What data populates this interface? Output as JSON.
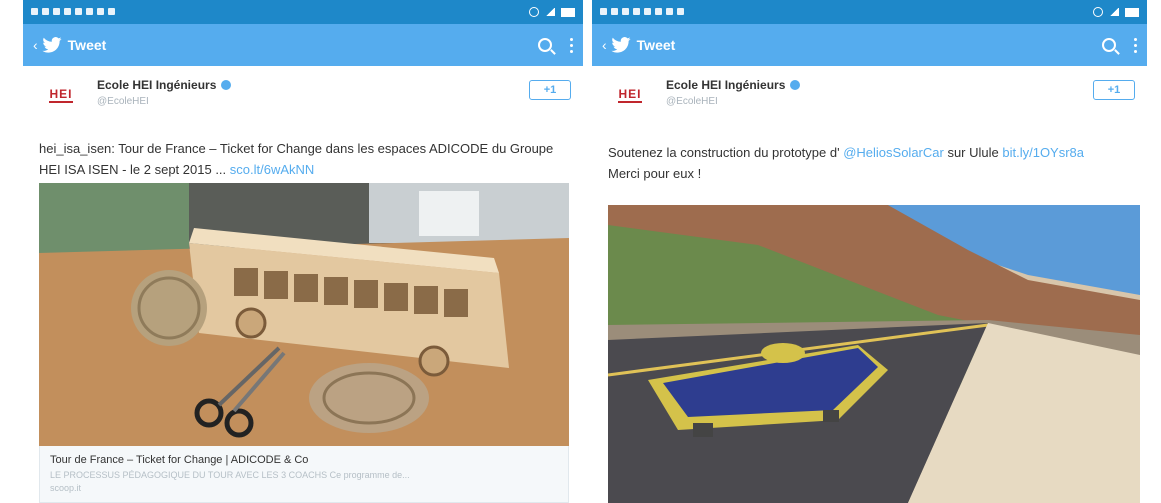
{
  "left": {
    "app_title": "Tweet",
    "account": {
      "name": "Ecole HEI Ingénieurs",
      "handle": "@EcoleHEI",
      "avatar_text": "HEI"
    },
    "follow_label": "+1",
    "tweet": {
      "text": "hei_isa_isen: Tour de France – Ticket for Change dans les espaces ADICODE du Groupe HEI ISA ISEN - le 2 sept 2015 ...",
      "link": "sco.lt/6wAkNN"
    },
    "card": {
      "title": "Tour de France – Ticket for Change | ADICODE & Co",
      "description": "LE PROCESSUS PÉDAGOGIQUE DU TOUR AVEC LES 3 COACHS Ce programme de...",
      "domain": "scoop.it"
    },
    "media_icon": "photo-bus-scissors-twine"
  },
  "right": {
    "app_title": "Tweet",
    "account": {
      "name": "Ecole HEI Ingénieurs",
      "handle": "@EcoleHEI",
      "avatar_text": "HEI"
    },
    "follow_label": "+1",
    "tweet": {
      "text_prefix": "Soutenez la construction du prototype d'",
      "mention": "@HeliosSolarCar",
      "text_mid": "sur Ulule",
      "link": "bit.ly/1OYsr8a",
      "line2": "Merci pour eux !"
    },
    "media_icon": "photo-solar-car-road"
  },
  "colors": {
    "statusbar": "#1e88c9",
    "appbar": "#55acee",
    "link": "#55acee",
    "brand": "#c0262d"
  }
}
